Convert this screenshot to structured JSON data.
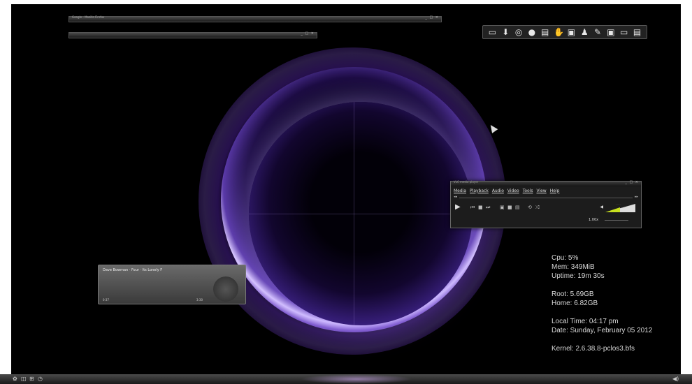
{
  "windows": {
    "top1_title": "Google - Mozilla Firefox",
    "top2_title": "",
    "controls": "_ □ ×"
  },
  "dock": {
    "icons": [
      "desktop-icon",
      "download-icon",
      "chrome-icon",
      "chat-icon",
      "calculator-icon",
      "hand-icon",
      "monitor-icon",
      "chess-icon",
      "brush-icon",
      "package-icon",
      "terminal-icon",
      "clipboard-icon"
    ],
    "glyphs": [
      "▭",
      "⬇",
      "◎",
      "●",
      "▤",
      "✋",
      "▣",
      "♟",
      "✎",
      "▣",
      "▭",
      "▤"
    ]
  },
  "player": {
    "title": "VLC media player",
    "controls": "_ □ ×",
    "menu": [
      "Media",
      "Playback",
      "Audio",
      "Video",
      "Tools",
      "View",
      "Help"
    ],
    "seek_left": "◂◂",
    "seek_right": "▸▸",
    "play": "▶",
    "buttons": [
      "⏮",
      "■",
      "⏭",
      "▣",
      "■",
      "▤",
      "⟲",
      "⤮"
    ],
    "volume_percent": "100%",
    "volume_level": 0.5,
    "rate": "1.00x",
    "accent": "#c8e020"
  },
  "conky": {
    "cpu": "Cpu: 5%",
    "mem": "Mem: 349MiB",
    "uptime": "Uptime: 19m 30s",
    "root": "Root: 5.69GB",
    "home": "Home: 6.82GB",
    "local_time": "Local Time: 04:17 pm",
    "date": "Date: Sunday, February 05 2012",
    "kernel": "Kernel: 2.6.38.8-pclos3.bfs"
  },
  "music": {
    "song": "Dave Bowman · Four · Its Lonely F",
    "elapsed": "0:37",
    "total": "3:30"
  },
  "taskbar": {
    "start": "✿",
    "icons": [
      "◫",
      "⊞",
      "◷"
    ],
    "tray": "◀)"
  }
}
